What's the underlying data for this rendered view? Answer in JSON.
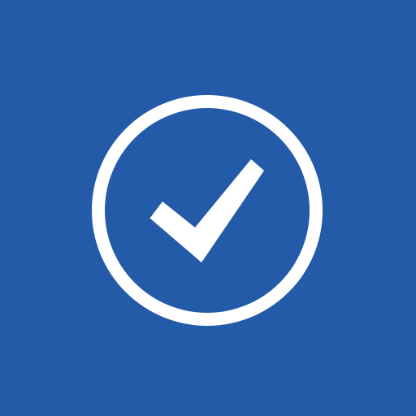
{
  "icon": {
    "name": "check-circle-icon",
    "background_color": "#245ba8",
    "foreground_color": "#ffffff"
  }
}
